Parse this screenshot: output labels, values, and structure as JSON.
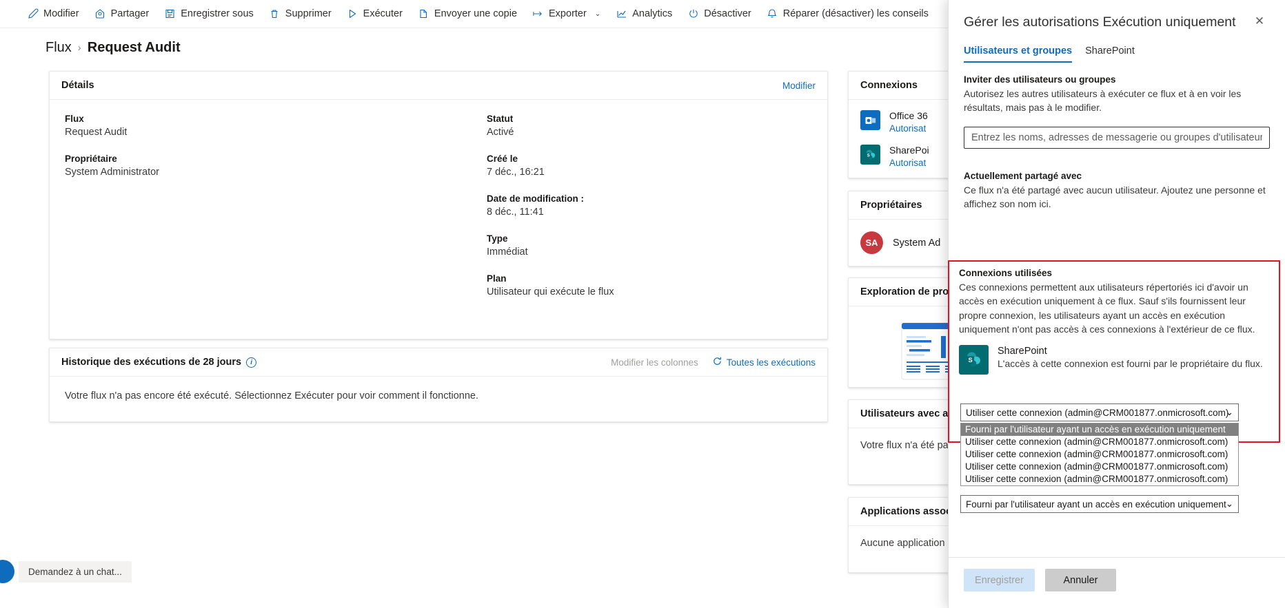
{
  "commandbar": {
    "items": [
      {
        "label": "Modifier",
        "icon": "pencil-icon"
      },
      {
        "label": "Partager",
        "icon": "share-icon"
      },
      {
        "label": "Enregistrer sous",
        "icon": "save-as-icon"
      },
      {
        "label": "Supprimer",
        "icon": "delete-icon"
      },
      {
        "label": "Exécuter",
        "icon": "run-icon"
      },
      {
        "label": "Envoyer une copie",
        "icon": "send-copy-icon"
      },
      {
        "label": "Exporter",
        "icon": "export-icon",
        "chevron": "⌄"
      },
      {
        "label": "Analytics",
        "icon": "analytics-icon"
      },
      {
        "label": "Désactiver",
        "icon": "power-icon"
      },
      {
        "label": "Réparer (désactiver) les conseils",
        "icon": "bell-icon"
      }
    ]
  },
  "breadcrumb": {
    "root": "Flux",
    "separator": "›",
    "current": "Request Audit"
  },
  "details": {
    "title": "Détails",
    "edit_link": "Modifier",
    "left": [
      {
        "label": "Flux",
        "value": "Request Audit"
      },
      {
        "label": "Propriétaire",
        "value": "System Administrator"
      }
    ],
    "right": [
      {
        "label": "Statut",
        "value": "Activé"
      },
      {
        "label": "Créé le",
        "value": "7 déc., 16:21"
      },
      {
        "label": "Date de modification :",
        "value": "8 déc., 11:41"
      },
      {
        "label": "Type",
        "value": "Immédiat"
      },
      {
        "label": "Plan",
        "value": "Utilisateur qui exécute le flux"
      }
    ]
  },
  "history": {
    "title": "Historique des exécutions de 28 jours",
    "info_icon": "i",
    "edit_columns": "Modifier les colonnes",
    "all_runs": "Toutes les exécutions",
    "empty_message": "Votre flux n'a pas encore été exécuté. Sélectionnez Exécuter pour voir comment il fonctionne."
  },
  "side_cards": {
    "connections": {
      "title": "Connexions",
      "rows": [
        {
          "name": "Office 36",
          "sub": "Autorisat",
          "icon": "office365-outlook-icon"
        },
        {
          "name": "SharePoi",
          "sub": "Autorisat",
          "icon": "sharepoint-icon"
        }
      ]
    },
    "owners": {
      "title": "Propriétaires",
      "rows": [
        {
          "initials": "SA",
          "name": "System Ad"
        }
      ]
    },
    "process_mining": {
      "title": "Exploration de pro"
    },
    "runonly_users": {
      "title": "Utilisateurs avec a",
      "empty": "Votre flux n'a été pa"
    },
    "associated_apps": {
      "title": "Applications assoc",
      "empty": "Aucune application"
    }
  },
  "panel": {
    "title": "Gérer les autorisations Exécution uniquement",
    "close_icon": "✕",
    "tabs": [
      {
        "label": "Utilisateurs et groupes",
        "active": true
      },
      {
        "label": "SharePoint",
        "active": false
      }
    ],
    "invite": {
      "title": "Inviter des utilisateurs ou groupes",
      "description": "Autorisez les autres utilisateurs à exécuter ce flux et à en voir les résultats, mais pas à le modifier.",
      "input_placeholder": "Entrez les noms, adresses de messagerie ou groupes d'utilisateurs",
      "input_value": ""
    },
    "shared_with": {
      "title": "Actuellement partagé avec",
      "description": "Ce flux n'a été partagé avec aucun utilisateur. Ajoutez une personne et affichez son nom ici."
    },
    "connections_used": {
      "title": "Connexions utilisées",
      "description": "Ces connexions permettent aux utilisateurs répertoriés ici d'avoir un accès en exécution uniquement à ce flux. Sauf s'ils fournissent leur propre connexion, les utilisateurs ayant un accès en exécution uniquement n'ont pas accès à ces connexions à l'extérieur de ce flux.",
      "connection": {
        "name": "SharePoint",
        "description": "L'accès à cette connexion est fourni par le propriétaire du flux.",
        "icon": "sharepoint-icon"
      },
      "select_top": {
        "value": "Utiliser cette connexion (admin@CRM001877.onmicrosoft.com)",
        "caret": "⌄",
        "expanded": true,
        "options": [
          {
            "label": "Fourni par l'utilisateur ayant un accès en exécution uniquement",
            "selected": true
          },
          {
            "label": "Utiliser cette connexion (admin@CRM001877.onmicrosoft.com)",
            "selected": false
          },
          {
            "label": "Utiliser cette connexion (admin@CRM001877.onmicrosoft.com)",
            "selected": false
          },
          {
            "label": "Utiliser cette connexion (admin@CRM001877.onmicrosoft.com)",
            "selected": false
          },
          {
            "label": "Utiliser cette connexion (admin@CRM001877.onmicrosoft.com)",
            "selected": false
          }
        ]
      },
      "select_bottom": {
        "value": "Fourni par l'utilisateur ayant un accès en exécution uniquement",
        "caret": "⌄"
      },
      "highlight_color": "#e81123"
    },
    "footer": {
      "save": "Enregistrer",
      "cancel": "Annuler"
    }
  },
  "chat": {
    "placeholder": "Demandez à un chat..."
  },
  "colors": {
    "accent": "#0f6cbd",
    "highlight": "#e81123",
    "sharepoint": "#036c70",
    "avatar": "#c8383f"
  }
}
